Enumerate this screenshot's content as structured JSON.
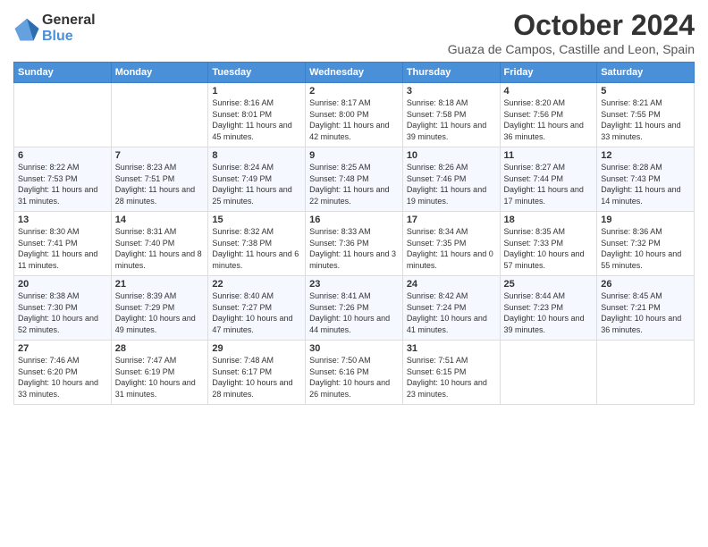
{
  "logo": {
    "general": "General",
    "blue": "Blue"
  },
  "title": "October 2024",
  "subtitle": "Guaza de Campos, Castille and Leon, Spain",
  "weekdays": [
    "Sunday",
    "Monday",
    "Tuesday",
    "Wednesday",
    "Thursday",
    "Friday",
    "Saturday"
  ],
  "weeks": [
    [
      {
        "day": "",
        "info": ""
      },
      {
        "day": "",
        "info": ""
      },
      {
        "day": "1",
        "info": "Sunrise: 8:16 AM\nSunset: 8:01 PM\nDaylight: 11 hours and 45 minutes."
      },
      {
        "day": "2",
        "info": "Sunrise: 8:17 AM\nSunset: 8:00 PM\nDaylight: 11 hours and 42 minutes."
      },
      {
        "day": "3",
        "info": "Sunrise: 8:18 AM\nSunset: 7:58 PM\nDaylight: 11 hours and 39 minutes."
      },
      {
        "day": "4",
        "info": "Sunrise: 8:20 AM\nSunset: 7:56 PM\nDaylight: 11 hours and 36 minutes."
      },
      {
        "day": "5",
        "info": "Sunrise: 8:21 AM\nSunset: 7:55 PM\nDaylight: 11 hours and 33 minutes."
      }
    ],
    [
      {
        "day": "6",
        "info": "Sunrise: 8:22 AM\nSunset: 7:53 PM\nDaylight: 11 hours and 31 minutes."
      },
      {
        "day": "7",
        "info": "Sunrise: 8:23 AM\nSunset: 7:51 PM\nDaylight: 11 hours and 28 minutes."
      },
      {
        "day": "8",
        "info": "Sunrise: 8:24 AM\nSunset: 7:49 PM\nDaylight: 11 hours and 25 minutes."
      },
      {
        "day": "9",
        "info": "Sunrise: 8:25 AM\nSunset: 7:48 PM\nDaylight: 11 hours and 22 minutes."
      },
      {
        "day": "10",
        "info": "Sunrise: 8:26 AM\nSunset: 7:46 PM\nDaylight: 11 hours and 19 minutes."
      },
      {
        "day": "11",
        "info": "Sunrise: 8:27 AM\nSunset: 7:44 PM\nDaylight: 11 hours and 17 minutes."
      },
      {
        "day": "12",
        "info": "Sunrise: 8:28 AM\nSunset: 7:43 PM\nDaylight: 11 hours and 14 minutes."
      }
    ],
    [
      {
        "day": "13",
        "info": "Sunrise: 8:30 AM\nSunset: 7:41 PM\nDaylight: 11 hours and 11 minutes."
      },
      {
        "day": "14",
        "info": "Sunrise: 8:31 AM\nSunset: 7:40 PM\nDaylight: 11 hours and 8 minutes."
      },
      {
        "day": "15",
        "info": "Sunrise: 8:32 AM\nSunset: 7:38 PM\nDaylight: 11 hours and 6 minutes."
      },
      {
        "day": "16",
        "info": "Sunrise: 8:33 AM\nSunset: 7:36 PM\nDaylight: 11 hours and 3 minutes."
      },
      {
        "day": "17",
        "info": "Sunrise: 8:34 AM\nSunset: 7:35 PM\nDaylight: 11 hours and 0 minutes."
      },
      {
        "day": "18",
        "info": "Sunrise: 8:35 AM\nSunset: 7:33 PM\nDaylight: 10 hours and 57 minutes."
      },
      {
        "day": "19",
        "info": "Sunrise: 8:36 AM\nSunset: 7:32 PM\nDaylight: 10 hours and 55 minutes."
      }
    ],
    [
      {
        "day": "20",
        "info": "Sunrise: 8:38 AM\nSunset: 7:30 PM\nDaylight: 10 hours and 52 minutes."
      },
      {
        "day": "21",
        "info": "Sunrise: 8:39 AM\nSunset: 7:29 PM\nDaylight: 10 hours and 49 minutes."
      },
      {
        "day": "22",
        "info": "Sunrise: 8:40 AM\nSunset: 7:27 PM\nDaylight: 10 hours and 47 minutes."
      },
      {
        "day": "23",
        "info": "Sunrise: 8:41 AM\nSunset: 7:26 PM\nDaylight: 10 hours and 44 minutes."
      },
      {
        "day": "24",
        "info": "Sunrise: 8:42 AM\nSunset: 7:24 PM\nDaylight: 10 hours and 41 minutes."
      },
      {
        "day": "25",
        "info": "Sunrise: 8:44 AM\nSunset: 7:23 PM\nDaylight: 10 hours and 39 minutes."
      },
      {
        "day": "26",
        "info": "Sunrise: 8:45 AM\nSunset: 7:21 PM\nDaylight: 10 hours and 36 minutes."
      }
    ],
    [
      {
        "day": "27",
        "info": "Sunrise: 7:46 AM\nSunset: 6:20 PM\nDaylight: 10 hours and 33 minutes."
      },
      {
        "day": "28",
        "info": "Sunrise: 7:47 AM\nSunset: 6:19 PM\nDaylight: 10 hours and 31 minutes."
      },
      {
        "day": "29",
        "info": "Sunrise: 7:48 AM\nSunset: 6:17 PM\nDaylight: 10 hours and 28 minutes."
      },
      {
        "day": "30",
        "info": "Sunrise: 7:50 AM\nSunset: 6:16 PM\nDaylight: 10 hours and 26 minutes."
      },
      {
        "day": "31",
        "info": "Sunrise: 7:51 AM\nSunset: 6:15 PM\nDaylight: 10 hours and 23 minutes."
      },
      {
        "day": "",
        "info": ""
      },
      {
        "day": "",
        "info": ""
      }
    ]
  ]
}
